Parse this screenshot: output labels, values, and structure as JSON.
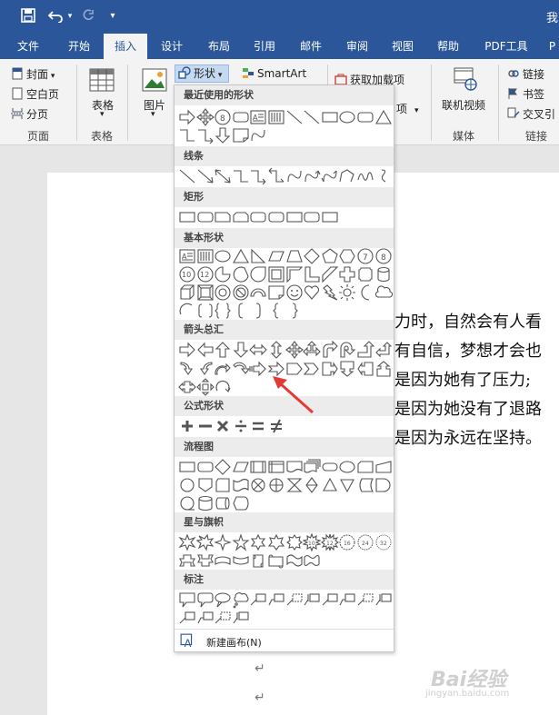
{
  "titlebar": {
    "save_icon": "save-icon",
    "undo_icon": "undo-icon",
    "redo_icon": "redo-icon",
    "customize_icon": "customize-quick-access-icon",
    "title_fragment": "我"
  },
  "tabs": [
    "文件",
    "开始",
    "插入",
    "设计",
    "布局",
    "引用",
    "邮件",
    "审阅",
    "视图",
    "帮助",
    "PDF工具",
    "P"
  ],
  "active_tab": "插入",
  "ribbon": {
    "pages": {
      "cover": "封面",
      "blank": "空白页",
      "break": "分页",
      "label": "页面"
    },
    "table": {
      "button": "表格",
      "label": "表格"
    },
    "picture": {
      "button": "图片"
    },
    "shapes_button": "形状",
    "smartart": "SmartArt",
    "addins": "获取加载项",
    "addins_frag": "项",
    "media": {
      "button": "联机视频",
      "label": "媒体"
    },
    "links": {
      "link": "链接",
      "bookmark": "书签",
      "cross_ref": "交叉引",
      "label": "链接"
    }
  },
  "dropdown": {
    "sections": [
      "最近使用的形状",
      "线条",
      "矩形",
      "基本形状",
      "箭头总汇",
      "公式形状",
      "流程图",
      "星与旗帜",
      "标注"
    ],
    "new_canvas": "新建画布(N)",
    "selected_shape": "notched-right-arrow"
  },
  "document": {
    "lines": [
      "力时，自然会有人看",
      "有自信，梦想才会也",
      "是因为她有了压力;",
      "是因为她没有了退路",
      "是因为永远在坚持。"
    ],
    "para_mark": "↵"
  },
  "watermark": {
    "text": "Bai经验",
    "sub": "jingyan.baidu.com"
  }
}
